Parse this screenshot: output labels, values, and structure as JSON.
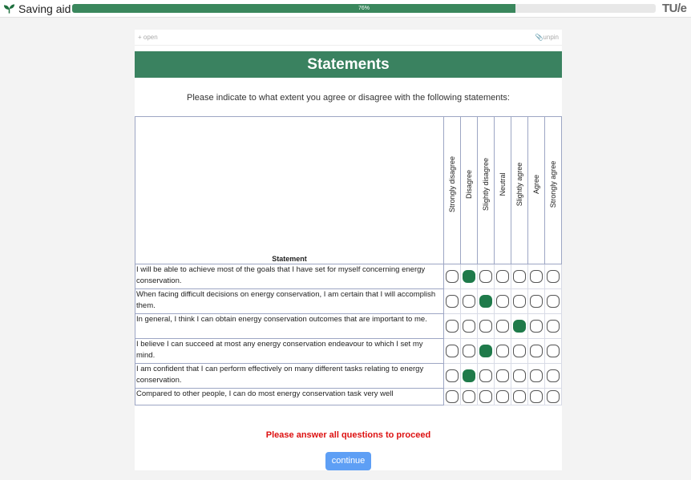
{
  "app": {
    "title": "Saving aid",
    "progress_percent": 76,
    "progress_label": "76%",
    "logo_text": "TU/e"
  },
  "pinbar": {
    "open_label": "+ open",
    "unpin_label": "unpin"
  },
  "page": {
    "title": "Statements",
    "instructions": "Please indicate to what extent you agree or disagree with the following statements:"
  },
  "table": {
    "statement_header": "Statement",
    "scale": [
      "Strongly disagree",
      "Disagree",
      "Slightly disagree",
      "Neutral",
      "Slightly agree",
      "Agree",
      "Strongly agree"
    ],
    "rows": [
      {
        "text": "I will be able to achieve most of the goals that I have set for myself concerning energy conservation.",
        "selected": 1
      },
      {
        "text": "When facing difficult decisions on energy conservation, I am certain that I will accomplish them.",
        "selected": 2
      },
      {
        "text": "In general, I think I can obtain energy conservation outcomes that are important to me.",
        "selected": 4
      },
      {
        "text": "I believe I can succeed at most any energy conservation endeavour to which I set my mind.",
        "selected": 2
      },
      {
        "text": "I am confident that I can perform effectively on many different tasks relating to energy conservation.",
        "selected": 1
      },
      {
        "text": "Compared to other people, I can do most energy conservation task very well",
        "selected": -1
      }
    ]
  },
  "error_message": "Please answer all questions to proceed",
  "continue_label": "continue",
  "colors": {
    "accent_green": "#3a8260",
    "selected_radio": "#1f7a4a",
    "error": "#dd1111",
    "button": "#5e9ff5"
  }
}
